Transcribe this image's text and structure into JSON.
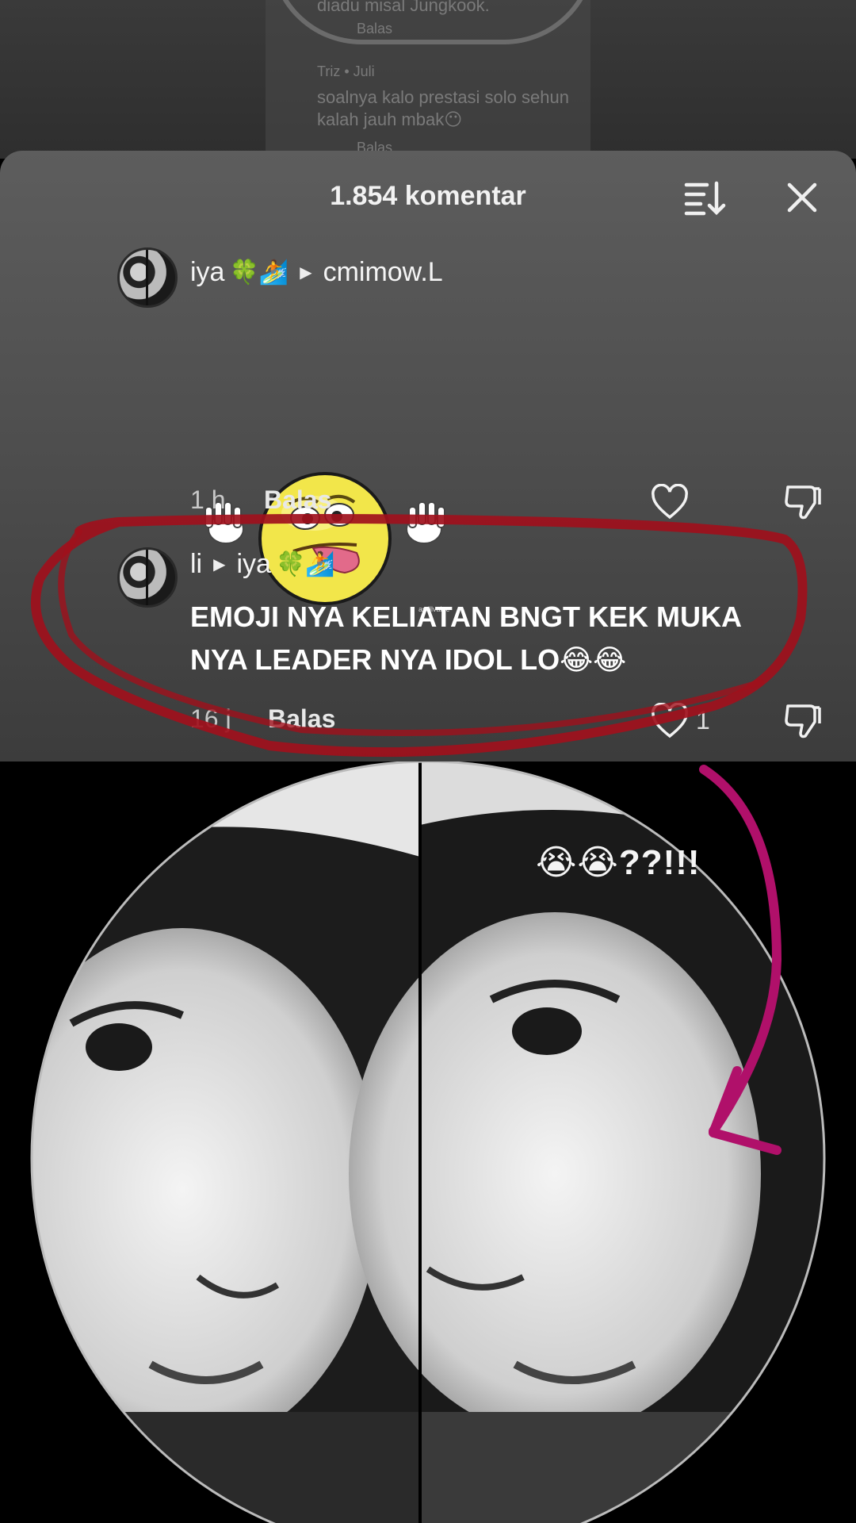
{
  "background": {
    "line1": "diadu misal Jungkook.",
    "reply_label": "Balas",
    "commenter": "Triz • Juli",
    "text_line1": "soalnya kalo prestasi solo sehun",
    "text_line2": "kalah jauh mbak😶",
    "reply_label_2": "Balas"
  },
  "sheet": {
    "title": "1.854 komentar",
    "sort_icon": "sort-descending-icon",
    "close_icon": "close-icon"
  },
  "comments": [
    {
      "username": "iya",
      "username_emojis": "🍀🏄",
      "reply_to": "cmimow.L",
      "sticker": "silly-face-sticker",
      "sticker_tag": "astillvalue",
      "time": "1 h",
      "reply_label": "Balas",
      "likes": ""
    },
    {
      "username": "li",
      "reply_to": "iya",
      "reply_to_emojis": "🍀🏄",
      "text_line1": "EMOJI NYA KELIATAN BNGT KEK MUKA",
      "text_line2": "NYA LEADER NYA IDOL LO😂😂",
      "time": "16 j",
      "reply_label": "Balas",
      "likes": "1"
    }
  ],
  "overlay": {
    "reaction_text": "😭😭??!!!",
    "highlight_color": "#a0101c",
    "arrow_color": "#b0106a"
  }
}
